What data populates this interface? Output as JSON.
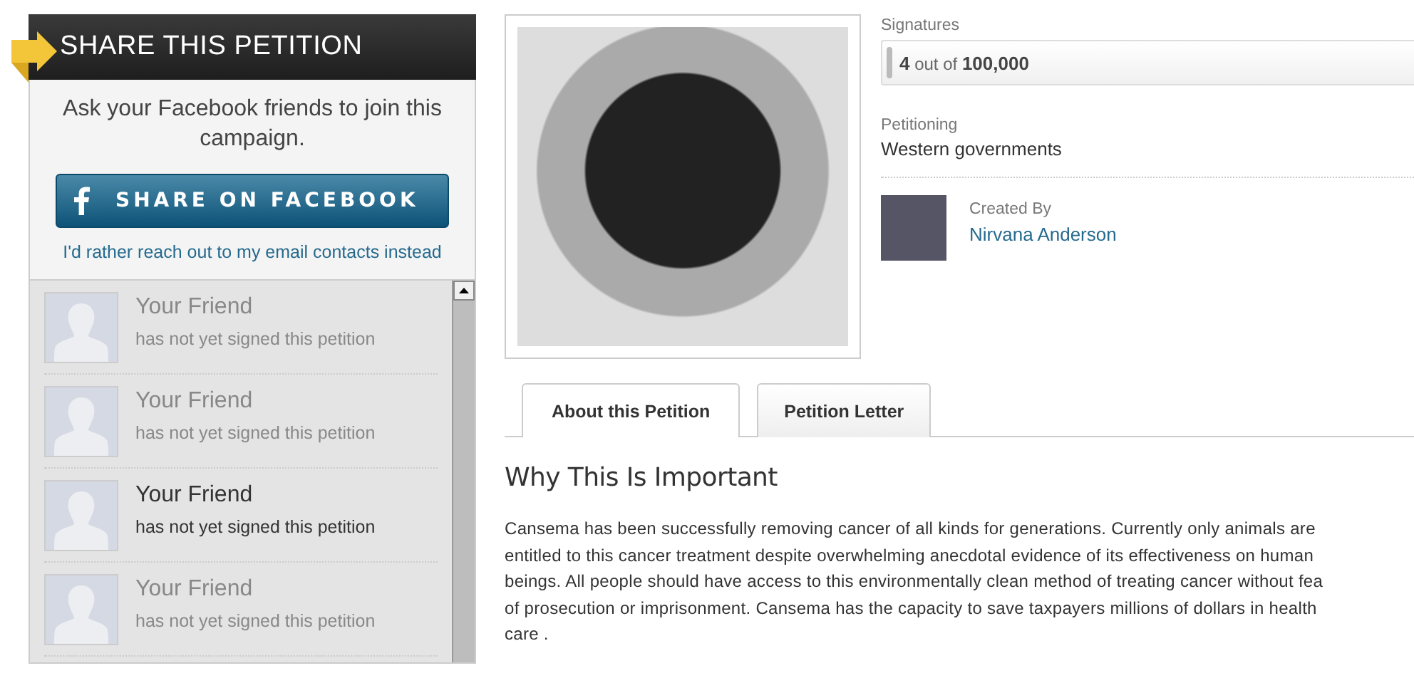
{
  "share_panel": {
    "title": "SHARE THIS PETITION",
    "prompt": "Ask your Facebook friends to join this campaign.",
    "facebook_button": "SHARE ON FACEBOOK",
    "email_link": "I'd rather reach out to my email contacts instead",
    "friends": [
      {
        "name": "Your Friend",
        "status": "has not yet signed this petition",
        "highlighted": false
      },
      {
        "name": "Your Friend",
        "status": "has not yet signed this petition",
        "highlighted": false
      },
      {
        "name": "Your Friend",
        "status": "has not yet signed this petition",
        "highlighted": true
      },
      {
        "name": "Your Friend",
        "status": "has not yet signed this petition",
        "highlighted": false
      }
    ]
  },
  "signatures": {
    "label": "Signatures",
    "count": "4",
    "separator": "out of",
    "goal": "100,000",
    "level": 4e-05
  },
  "petitioning": {
    "label": "Petitioning",
    "value": "Western governments"
  },
  "creator": {
    "label": "Created By",
    "name": "Nirvana Anderson"
  },
  "tabs": [
    {
      "label": "About this Petition",
      "selected": true
    },
    {
      "label": "Petition Letter",
      "selected": false
    }
  ],
  "section": {
    "heading": "Why This Is Important",
    "lines": [
      "Cansema has been successfully removing cancer of all kinds for generations. Currently only animals are",
      "entitled to this cancer treatment despite overwhelming anecdotal evidence of its effectiveness on human",
      "beings. All people should have access to this environmentally clean method of treating cancer without fea",
      "of prosecution or imprisonment. Cansema has the capacity to save taxpayers millions of dollars in health",
      "care ."
    ]
  }
}
